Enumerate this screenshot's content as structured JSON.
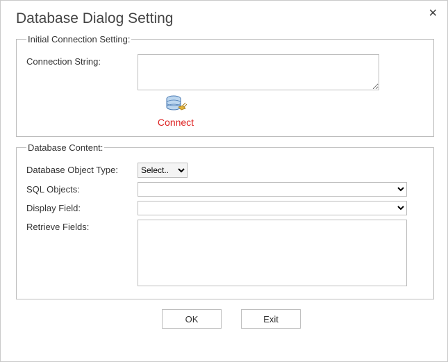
{
  "title": "Database Dialog Setting",
  "close": "✕",
  "group1": {
    "legend": "Initial Connection Setting:",
    "connection_string_label": "Connection String:",
    "connection_string_value": "",
    "connect_label": "Connect"
  },
  "group2": {
    "legend": "Database Content:",
    "object_type_label": "Database Object Type:",
    "object_type_value": "Select..",
    "sql_objects_label": "SQL Objects:",
    "sql_objects_value": "",
    "display_field_label": "Display Field:",
    "display_field_value": "",
    "retrieve_fields_label": "Retrieve Fields:",
    "retrieve_fields_value": ""
  },
  "buttons": {
    "ok": "OK",
    "exit": "Exit"
  }
}
